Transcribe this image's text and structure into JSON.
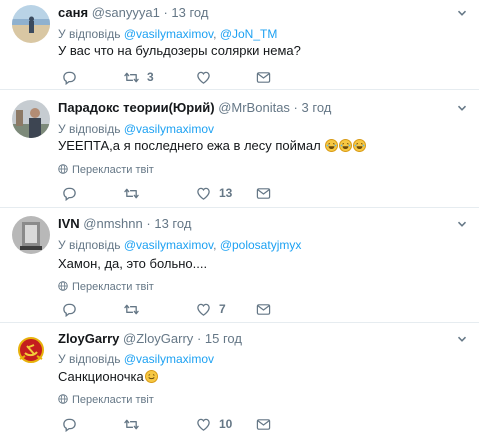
{
  "tweets": [
    {
      "name": "саня",
      "handle": "@sanyyya1",
      "dot": "·",
      "time": "13 год",
      "reply_prefix": "У відповідь",
      "reply_to": [
        "@vasilymaximov",
        "@JoN_TM"
      ],
      "text": "У вас что на бульдозеры солярки нема?",
      "translate": "",
      "counts": {
        "replies": "",
        "retweets": "3",
        "likes": ""
      }
    },
    {
      "name": "Парадокс теории(Юрий)",
      "handle": "@MrBonitas",
      "dot": "·",
      "time": "3 год",
      "reply_prefix": "У відповідь",
      "reply_to": [
        "@vasilymaximov"
      ],
      "text": "УЕЕПТА,а я последнего ежа в лесу поймал",
      "translate": "Перекласти твіт",
      "counts": {
        "replies": "",
        "retweets": "",
        "likes": "13"
      }
    },
    {
      "name": "IVN",
      "handle": "@nmshnn",
      "dot": "·",
      "time": "13 год",
      "reply_prefix": "У відповідь",
      "reply_to": [
        "@vasilymaximov",
        "@polosatyjmyx"
      ],
      "text": "Хамон, да, это больно....",
      "translate": "Перекласти твіт",
      "counts": {
        "replies": "",
        "retweets": "",
        "likes": "7"
      }
    },
    {
      "name": "ZloyGarry",
      "handle": "@ZloyGarry",
      "dot": "·",
      "time": "15 год",
      "reply_prefix": "У відповідь",
      "reply_to": [
        "@vasilymaximov"
      ],
      "text": "Санкционочка",
      "translate": "Перекласти твіт",
      "counts": {
        "replies": "",
        "retweets": "",
        "likes": "10"
      }
    }
  ],
  "reply_separator": ",",
  "colors": {
    "link": "#1da1f2",
    "muted": "#657786",
    "text": "#14171a",
    "divider": "#e6ecf0"
  },
  "icons": [
    "reply-icon",
    "retweet-icon",
    "like-icon",
    "direct-message-icon",
    "chevron-down-icon",
    "globe-icon",
    "laughing-emoji",
    "smiling-emoji"
  ]
}
